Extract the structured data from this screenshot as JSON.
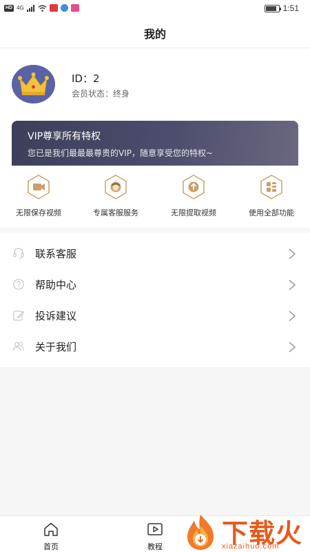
{
  "status_bar": {
    "hd": "HD",
    "signal": "4G",
    "time": "1:51",
    "battery_level": 0.85
  },
  "header": {
    "title": "我的"
  },
  "profile": {
    "id_label": "ID：2",
    "member_status": "会员状态：终身"
  },
  "vip": {
    "title": "VIP尊享所有特权",
    "description": "您已是我们最最最尊贵的VIP，随意享受您的特权~"
  },
  "privileges": [
    {
      "label": "无限保存视频",
      "icon": "video-camera-icon"
    },
    {
      "label": "专属客服服务",
      "icon": "customer-service-icon"
    },
    {
      "label": "无限提取视频",
      "icon": "extract-upload-icon"
    },
    {
      "label": "使用全部功能",
      "icon": "all-features-icon"
    }
  ],
  "menu": [
    {
      "label": "联系客服",
      "icon": "headset-icon"
    },
    {
      "label": "帮助中心",
      "icon": "help-icon"
    },
    {
      "label": "投诉建议",
      "icon": "edit-icon"
    },
    {
      "label": "关于我们",
      "icon": "users-icon"
    }
  ],
  "bottom_nav": [
    {
      "label": "首页",
      "icon": "home-icon"
    },
    {
      "label": "教程",
      "icon": "play-icon"
    }
  ],
  "watermark": {
    "text": "下载火",
    "sub": "xiazaihuo.com"
  },
  "colors": {
    "accent_gold": "#c9a06a",
    "vip_card": "#43465f",
    "avatar_bg": "#5a62a6",
    "watermark": "#e8591b"
  }
}
